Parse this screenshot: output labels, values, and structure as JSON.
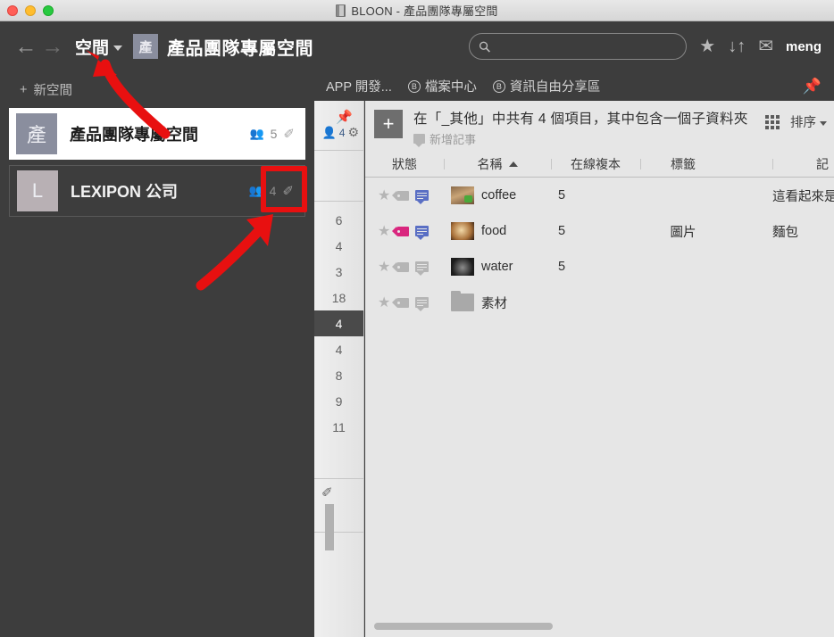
{
  "window": {
    "title": "BLOON - 產品團隊專屬空間",
    "app_icon": "app-icon"
  },
  "navbar": {
    "back_icon": "←",
    "forward_icon": "→",
    "breadcrumb_space_label": "空間",
    "badge_label": "產",
    "page_title": "產品團隊專屬空間",
    "search_placeholder": "",
    "search_value": "",
    "star_icon": "★",
    "sort_icon": "↓↑",
    "mail_icon": "✉",
    "user_name": "meng"
  },
  "tabs": {
    "items": [
      {
        "label": "APP 開發...",
        "has_b": false
      },
      {
        "label": "檔案中心",
        "has_b": true
      },
      {
        "label": "資訊自由分享區",
        "has_b": true
      }
    ],
    "b_letter": "B",
    "pin_icon": "pin-icon"
  },
  "rail": {
    "pin_icon": "pin-icon",
    "member_count": "4",
    "gear_icon": "gear-icon",
    "numbers": [
      "6",
      "4",
      "3",
      "18",
      "4",
      "4",
      "8",
      "9",
      "11"
    ],
    "active_index": 4,
    "pencil_icon": "pencil-icon"
  },
  "main": {
    "add_label": "+",
    "header_title": "在「_其他」中共有 4 個項目，其中包含一個子資料夾",
    "add_note_label": "新增記事",
    "grid_icon": "grid-view-icon",
    "sort_label": "排序",
    "columns": [
      "狀態",
      "名稱",
      "在線複本",
      "標籤",
      "",
      "記"
    ],
    "name_sort_direction": "asc",
    "rows": [
      {
        "name": "coffee",
        "thumb": "coffee",
        "copies": "5",
        "tag": "",
        "note": "這看起來是目前",
        "starred": false,
        "tag_colored": false,
        "comment_colored": true
      },
      {
        "name": "food",
        "thumb": "food",
        "copies": "5",
        "tag": "圖片",
        "note": "麵包",
        "starred": false,
        "tag_colored": true,
        "comment_colored": true
      },
      {
        "name": "water",
        "thumb": "water",
        "copies": "5",
        "tag": "",
        "note": "",
        "starred": false,
        "tag_colored": false,
        "comment_colored": false
      },
      {
        "name": "素材",
        "thumb": "folder",
        "copies": "",
        "tag": "",
        "note": "",
        "starred": false,
        "tag_colored": false,
        "comment_colored": false
      }
    ]
  },
  "sidepanel": {
    "new_space_label": "新空間",
    "new_space_icon": "+",
    "spaces": [
      {
        "avatar": "產",
        "name": "產品團隊專屬空間",
        "members": "5",
        "selected": true,
        "edit_icon": "pencil-icon"
      },
      {
        "avatar": "L",
        "name": "LEXIPON 公司",
        "members": "4",
        "selected": false,
        "edit_icon": "pencil-icon"
      }
    ]
  },
  "annotations": {
    "highlight_color": "#e81010",
    "arrow1": "arrow pointing up-left to 空間 dropdown",
    "arrow2": "arrow pointing up-right to LEXIPON edit pencil"
  }
}
